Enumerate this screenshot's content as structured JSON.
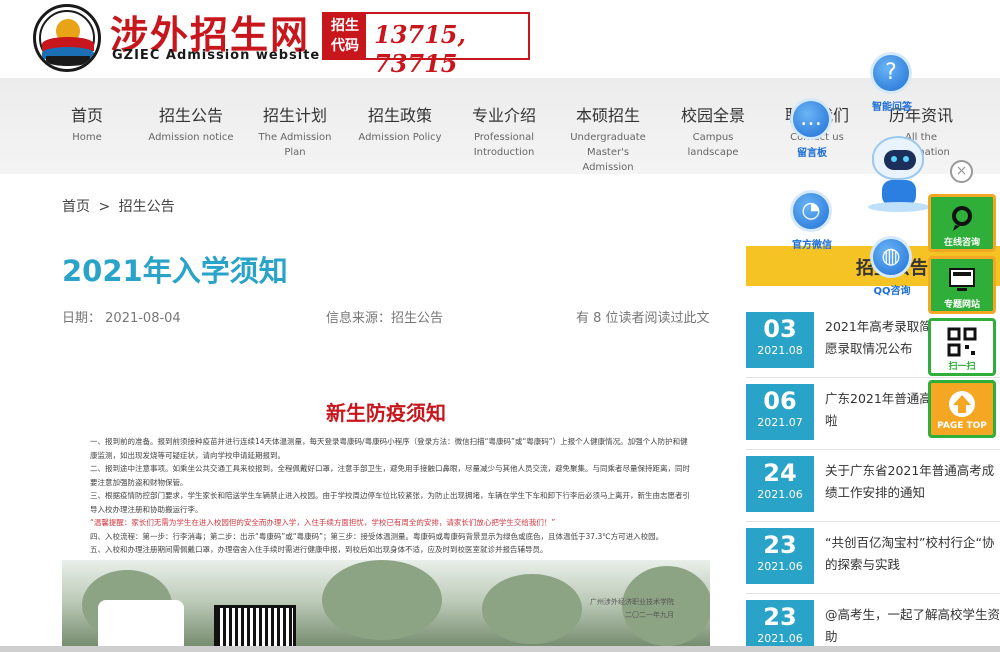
{
  "header": {
    "logo_cn": "涉外招生网",
    "logo_en": "GZIEC Admission website",
    "code_label_line1": "招生",
    "code_label_line2": "代码",
    "code_value": "13715, 73715"
  },
  "nav": {
    "items": [
      {
        "cn": "首页",
        "en": "Home"
      },
      {
        "cn": "招生公告",
        "en": "Admission notice"
      },
      {
        "cn": "招生计划",
        "en": "The Admission Plan"
      },
      {
        "cn": "招生政策",
        "en": "Admission Policy"
      },
      {
        "cn": "专业介绍",
        "en": "Professional Introduction"
      },
      {
        "cn": "本硕招生",
        "en": "Undergraduate Master's Admission"
      },
      {
        "cn": "校园全景",
        "en": "Campus landscape"
      },
      {
        "cn": "联系我们",
        "en": "Contact us"
      },
      {
        "cn": "历年资讯",
        "en": "All the information"
      }
    ]
  },
  "breadcrumb": {
    "home": "首页",
    "separator": ">",
    "current": "招生公告"
  },
  "article": {
    "title": "2021年入学须知",
    "date_label": "日期：",
    "date_value": "2021-08-04",
    "source": "信息来源：招生公告",
    "reads": "有 8 位读者阅读过此文"
  },
  "notice": {
    "title": "新生防疫须知",
    "paragraphs": [
      "一、报到前的准备。报到前须接种疫苗并进行连续14天体温测量，每天登录粤康码/粤康码小程序（登录方法：微信扫描“粤康码”或“粤康码”）上报个人健康情况。加强个人防护和健康监测，如出现发烧等可疑症状，请向学校申请延期报到。",
      "二、报到途中注意事项。如乘坐公共交通工具来校报到，全程佩戴好口罩，注意手部卫生，避免用手接触口鼻眼，尽量减少与其他人员交流，避免聚集。与同乘者尽量保持距离，同时要注意加强防盗和财物保管。",
      "三、根据疫情防控部门要求，学生家长和陪送学生车辆禁止进入校园。由于学校周边停车位比较紧张，为防止出现拥堵，车辆在学生下车和卸下行李后必须马上离开，新生由志愿者引导入校办理注册和协助搬运行李。"
    ],
    "warning": "“温馨提醒：家长们无需为学生在进入校园但的安全而办理入学，入住手续方面担忧，学校已有周全的安排，请家长们放心把学生交给我们！”",
    "paragraphs2": [
      "四、入校流程：第一步：行李消毒；第二步：出示“粤康码”或“粤康码”；第三步：接受体温测量。粤康码或粤康码背景显示为绿色或底色，且体温低于37.3℃方可进入校园。",
      "五、入校和办理注册期间需佩戴口罩，办理宿舍入住手续时需进行健康申报，到校后如出现身体不适，应及时到校医室就诊并报告辅导员。"
    ],
    "sign_school": "广州涉外经济职业技术学院",
    "sign_date": "二〇二一年九月"
  },
  "sidebar": {
    "header": "招生公告",
    "news": [
      {
        "day": "03",
        "ym": "2021.08",
        "title": "2021年高考录取简报：第一志愿录取情况公布"
      },
      {
        "day": "06",
        "ym": "2021.07",
        "title": "广东2021年普通高考分数线来啦"
      },
      {
        "day": "24",
        "ym": "2021.06",
        "title": "关于广东省2021年普通高考成绩工作安排的通知"
      },
      {
        "day": "23",
        "ym": "2021.06",
        "title": "“共创百亿淘宝村”校村行企“协的探索与实践"
      },
      {
        "day": "23",
        "ym": "2021.06",
        "title": "@高考生，一起了解高校学生资助"
      }
    ]
  },
  "floating": {
    "smart_qa": "智能问答",
    "message_board": "留言板",
    "official_wechat": "官方微信",
    "qq_consult": "QQ咨询",
    "close_symbol": "×",
    "tools": [
      {
        "label": "在线咨询",
        "icon": "chat-bubble-icon"
      },
      {
        "label": "专题网站",
        "icon": "monitor-icon"
      },
      {
        "label": "扫一扫",
        "icon": "qr-code-icon"
      },
      {
        "label": "PAGE TOP",
        "icon": "arrow-up-icon"
      }
    ]
  },
  "colors": {
    "brand_red": "#c8161d",
    "accent_blue": "#2aa3c8",
    "sidebar_yellow": "#f6c325",
    "tool_green": "#2fae3a",
    "tool_orange": "#f5a623"
  }
}
